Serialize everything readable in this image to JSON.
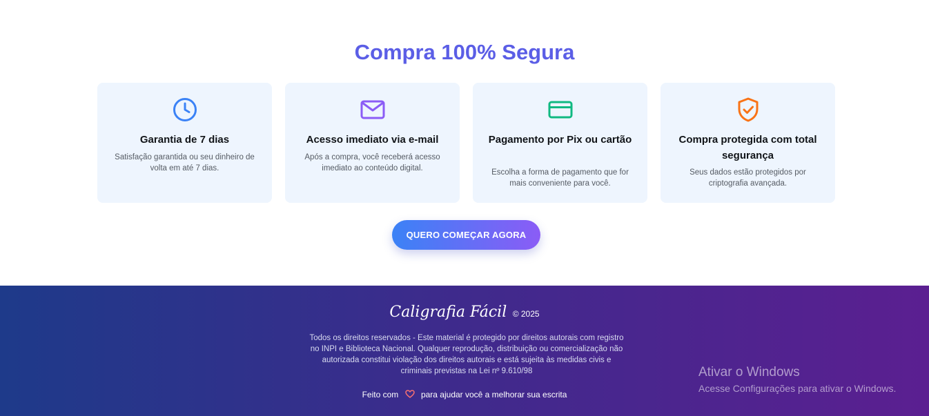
{
  "section": {
    "title": "Compra 100% Segura"
  },
  "cards": [
    {
      "icon": "clock-icon",
      "icon_color": "#3b82f6",
      "title": "Garantia de 7 dias",
      "text": "Satisfação garantida ou seu dinheiro de volta em até 7 dias."
    },
    {
      "icon": "mail-icon",
      "icon_color": "#8b5cf6",
      "title": "Acesso imediato via e-mail",
      "text": "Após a compra, você receberá acesso imediato ao conteúdo digital."
    },
    {
      "icon": "credit-card-icon",
      "icon_color": "#10b981",
      "title": "Pagamento por Pix ou cartão",
      "text": "Escolha a forma de pagamento que for mais conveniente para você."
    },
    {
      "icon": "shield-check-icon",
      "icon_color": "#f97316",
      "title": "Compra protegida com total segurança",
      "text": "Seus dados estão protegidos por criptografia avançada."
    }
  ],
  "cta": {
    "label": "QUERO COMEÇAR AGORA"
  },
  "footer": {
    "brand": "Caligrafia Fácil",
    "copyright": "© 2025",
    "legal": "Todos os direitos reservados - Este material é protegido por direitos autorais com registro no INPI e Biblioteca Nacional. Qualquer reprodução, distribuição ou comercialização não autorizada constitui violação dos direitos autorais e está sujeita às medidas civis e criminais previstas na Lei nº 9.610/98",
    "made_prefix": "Feito com",
    "made_suffix": "para ajudar você a melhorar sua escrita",
    "heart_icon": "heart-icon"
  },
  "watermark": {
    "title": "Ativar o Windows",
    "subtitle": "Acesse Configurações para ativar o Windows."
  },
  "colors": {
    "title": "#5b5ee6",
    "card_bg": "#eef5fe",
    "cta_gradient_start": "#3b82f6",
    "cta_gradient_end": "#8b5cf6",
    "footer_gradient_start": "#1e3a8a",
    "footer_gradient_end": "#5b1f91",
    "heart": "#f87171"
  }
}
